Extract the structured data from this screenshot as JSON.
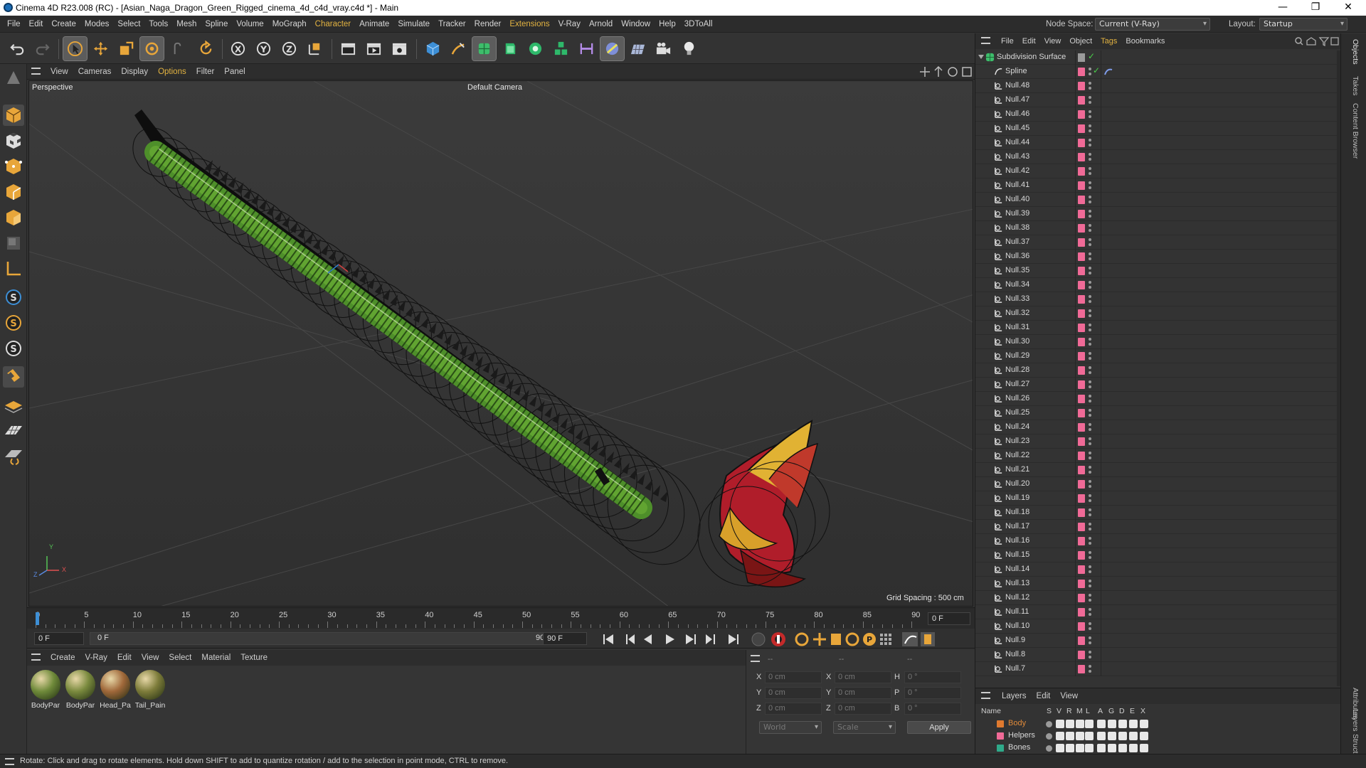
{
  "window": {
    "title": "Cinema 4D R23.008 (RC) - [Asian_Naga_Dragon_Green_Rigged_cinema_4d_c4d_vray.c4d *] - Main",
    "minimize": "—",
    "restore": "❐",
    "close": "✕"
  },
  "menubar": {
    "items": [
      "File",
      "Edit",
      "Create",
      "Modes",
      "Select",
      "Tools",
      "Mesh",
      "Spline",
      "Volume",
      "MoGraph",
      "Character",
      "Animate",
      "Simulate",
      "Tracker",
      "Render",
      "Extensions",
      "V-Ray",
      "Arnold",
      "Window",
      "Help",
      "3DToAll"
    ],
    "node_space_label": "Node Space:",
    "node_space_value": "Current (V-Ray)",
    "layout_label": "Layout:",
    "layout_value": "Startup"
  },
  "viewport": {
    "menu": [
      "View",
      "Cameras",
      "Display",
      "Options",
      "Filter",
      "Panel"
    ],
    "view_name": "Perspective",
    "camera": "Default Camera",
    "grid_spacing": "Grid Spacing : 500 cm",
    "axis_x": "X",
    "axis_y": "Y",
    "axis_z": "Z"
  },
  "timeline": {
    "ticks": [
      "0",
      "5",
      "10",
      "15",
      "20",
      "25",
      "30",
      "35",
      "40",
      "45",
      "50",
      "55",
      "60",
      "65",
      "70",
      "75",
      "80",
      "85",
      "90"
    ],
    "current_frame": "0 F",
    "start_frame": "0 F",
    "range_start": "0 F",
    "range_end": "90 F",
    "end_frame": "90 F"
  },
  "materials": {
    "menu": [
      "Create",
      "V-Ray",
      "Edit",
      "View",
      "Select",
      "Material",
      "Texture"
    ],
    "items": [
      {
        "label": "BodyPar",
        "color": "#6f8a3a"
      },
      {
        "label": "BodyPar",
        "color": "#7a8a3e"
      },
      {
        "label": "Head_Pa",
        "color": "#a0683a"
      },
      {
        "label": "Tail_Pain",
        "color": "#7d7c3a"
      }
    ]
  },
  "coordinates": {
    "header_dashes": [
      "--",
      "--",
      "--"
    ],
    "rows": [
      {
        "a": "X",
        "av": "0 cm",
        "b": "X",
        "bv": "0 cm",
        "c": "H",
        "cv": "0 °"
      },
      {
        "a": "Y",
        "av": "0 cm",
        "b": "Y",
        "bv": "0 cm",
        "c": "P",
        "cv": "0 °"
      },
      {
        "a": "Z",
        "av": "0 cm",
        "b": "Z",
        "bv": "0 cm",
        "c": "B",
        "cv": "0 °"
      }
    ],
    "space_select": "World",
    "mode_select": "Scale",
    "apply": "Apply"
  },
  "objects": {
    "menu": [
      "File",
      "Edit",
      "View",
      "Object",
      "Tags",
      "Bookmarks"
    ],
    "root": "Subdivision Surface",
    "spline": "Spline",
    "nulls": [
      "Null.48",
      "Null.47",
      "Null.46",
      "Null.45",
      "Null.44",
      "Null.43",
      "Null.42",
      "Null.41",
      "Null.40",
      "Null.39",
      "Null.38",
      "Null.37",
      "Null.36",
      "Null.35",
      "Null.34",
      "Null.33",
      "Null.32",
      "Null.31",
      "Null.30",
      "Null.29",
      "Null.28",
      "Null.27",
      "Null.26",
      "Null.25",
      "Null.24",
      "Null.23",
      "Null.22",
      "Null.21",
      "Null.20",
      "Null.19",
      "Null.18",
      "Null.17",
      "Null.16",
      "Null.15",
      "Null.14",
      "Null.13",
      "Null.12",
      "Null.11",
      "Null.10",
      "Null.9",
      "Null.8",
      "Null.7"
    ]
  },
  "layers": {
    "menu": [
      "Layers",
      "Edit",
      "View"
    ],
    "columns": [
      "Name",
      "S",
      "V",
      "R",
      "M",
      "L",
      "A",
      "G",
      "D",
      "E",
      "X"
    ],
    "rows": [
      {
        "name": "Body",
        "color": "#e07a2f",
        "text_color": "#e08a3a"
      },
      {
        "name": "Helpers",
        "color": "#f06a97",
        "text_color": "#d8d8d8"
      },
      {
        "name": "Bones",
        "color": "#2faa8a",
        "text_color": "#d8d8d8"
      }
    ]
  },
  "dock_tabs": [
    "Objects",
    "Takes",
    "Content Browser",
    "Attributes",
    "Layers",
    "Structure"
  ],
  "status": "Rotate: Click and drag to rotate elements. Hold down SHIFT to add to quantize rotation / add to the selection in point mode, CTRL to remove.",
  "colors": {
    "accent": "#e3b341",
    "tag_pink": "#f06a97",
    "dragon_green": "#5a9a2a",
    "dragon_gold": "#e0b030",
    "dragon_red": "#b0202a"
  }
}
